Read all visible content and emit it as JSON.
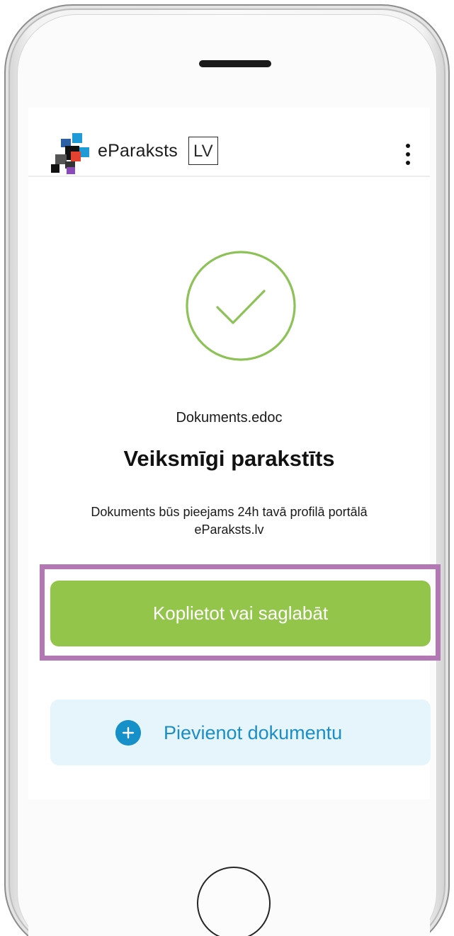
{
  "header": {
    "brand_name": "eParaksts",
    "brand_suffix": "LV"
  },
  "result": {
    "file_name": "Dokuments.edoc",
    "title": "Veiksmīgi parakstīts",
    "description": "Dokuments būs pieejams 24h tavā profilā portālā eParaksts.lv"
  },
  "actions": {
    "share_label": "Koplietot vai saglabāt",
    "add_label": "Pievienot dokumentu"
  },
  "colors": {
    "success_green": "#93c54b",
    "check_ring": "#8cc256",
    "link_blue": "#1b8ec7",
    "add_bg": "#e6f4fb",
    "highlight": "#b377b3"
  },
  "icons": {
    "check": "check-circle-icon",
    "menu": "more-vertical-icon",
    "add": "plus-circle-icon",
    "logo": "eparaksts-logo-icon"
  }
}
